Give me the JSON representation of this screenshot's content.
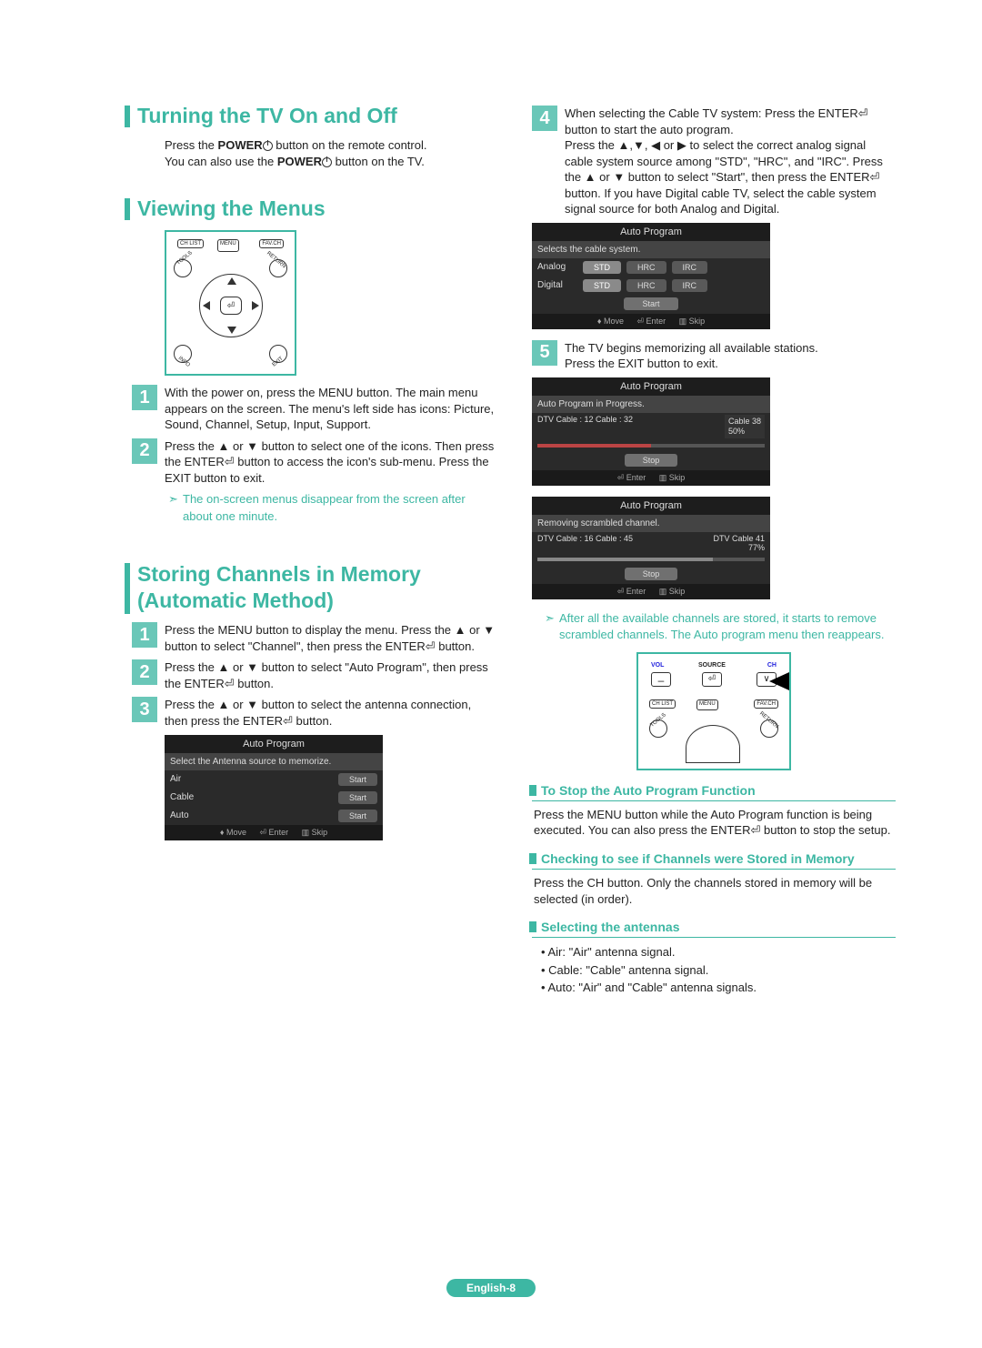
{
  "left": {
    "h1": "Turning the TV On and Off",
    "p1a": "Press the ",
    "p1b": "POWER",
    "p1c": " button on the remote control.",
    "p2a": "You can also use the ",
    "p2b": "POWER",
    "p2c": " button on the TV.",
    "h2": "Viewing the Menus",
    "remote_buttons": {
      "chlist": "CH LIST",
      "menu": "MENU",
      "favch": "FAV.CH",
      "tools": "TOOLS",
      "return": "RETURN",
      "info": "INFO",
      "exit": "EXIT"
    },
    "s1": "With the power on, press the MENU button. The main menu appears on the screen. The menu's left side has icons: Picture, Sound, Channel, Setup, Input, Support.",
    "s2": "Press the ▲ or ▼ button to select one of the icons. Then press the ENTER⏎ button to access the icon's sub-menu. Press the EXIT button to exit.",
    "note1": "The on-screen menus disappear from the screen after about one minute.",
    "h3a": "Storing Channels in Memory",
    "h3b": "(Automatic Method)",
    "s3": "Press the MENU button to display the menu. Press the ▲ or ▼ button to select \"Channel\", then press the ENTER⏎ button.",
    "s4": "Press the ▲ or ▼ button to select \"Auto Program\", then press the ENTER⏎ button.",
    "s5": "Press the ▲ or ▼ button to select the antenna connection, then press the ENTER⏎ button.",
    "osd1": {
      "title": "Auto Program",
      "sub": "Select the Antenna source to memorize.",
      "rows": [
        {
          "label": "Air",
          "btn": "Start"
        },
        {
          "label": "Cable",
          "btn": "Start"
        },
        {
          "label": "Auto",
          "btn": "Start"
        }
      ],
      "foot": [
        "♦ Move",
        "⏎ Enter",
        "▥ Skip"
      ]
    }
  },
  "right": {
    "s4": "When selecting the Cable TV system: Press the ENTER⏎ button to start the auto program.",
    "s4b": "Press the ▲,▼, ◀ or ▶ to select the correct analog signal cable system source among \"STD\", \"HRC\", and \"IRC\". Press the ▲ or ▼ button to select \"Start\", then press the ENTER⏎ button. If you have Digital cable TV, select the cable system signal source for both Analog and Digital.",
    "osd2": {
      "title": "Auto Program",
      "sub": "Selects the cable system.",
      "rows": [
        {
          "label": "Analog",
          "opts": [
            "STD",
            "HRC",
            "IRC"
          ],
          "sel": 0
        },
        {
          "label": "Digital",
          "opts": [
            "STD",
            "HRC",
            "IRC"
          ],
          "sel": 0
        }
      ],
      "start": "Start",
      "foot": [
        "♦ Move",
        "⏎ Enter",
        "▥ Skip"
      ]
    },
    "s5a": "The TV begins memorizing all available stations.",
    "s5b": "Press the EXIT button to exit.",
    "osd3": {
      "title": "Auto Program",
      "sub": "Auto Program in Progress.",
      "line": "DTV Cable : 12  Cable : 32",
      "rlab1": "Cable 38",
      "rlab2": "50%",
      "stop": "Stop",
      "foot": [
        "⏎ Enter",
        "▥ Skip"
      ]
    },
    "osd4": {
      "title": "Auto Program",
      "sub": "Removing scrambled channel.",
      "line": "DTV Cable : 16  Cable : 45",
      "rlab1": "DTV Cable 41",
      "rlab2": "77%",
      "stop": "Stop",
      "foot": [
        "⏎ Enter",
        "▥ Skip"
      ]
    },
    "note2": "After all the available channels are stored, it starts to remove scrambled channels. The Auto program menu then reappears.",
    "remote2": {
      "vol": "VOL",
      "source": "SOURCE",
      "ch": "CH",
      "chlist": "CH LIST",
      "menu": "MENU",
      "favch": "FAV.CH",
      "tools": "TOOLS",
      "return": "RETURN"
    },
    "sub1": "To Stop the Auto Program Function",
    "sub1_body": "Press the MENU button while the Auto Program function is being executed. You can also press the ENTER⏎ button to stop the setup.",
    "sub2": "Checking to see if Channels were Stored in Memory",
    "sub2_body": "Press the CH button. Only the channels stored in memory will be selected (in order).",
    "sub3": "Selecting the antennas",
    "bullets": [
      "Air: \"Air\" antenna signal.",
      "Cable: \"Cable\" antenna signal.",
      "Auto: \"Air\" and \"Cable\" antenna signals."
    ]
  },
  "pagenum": "English-8"
}
